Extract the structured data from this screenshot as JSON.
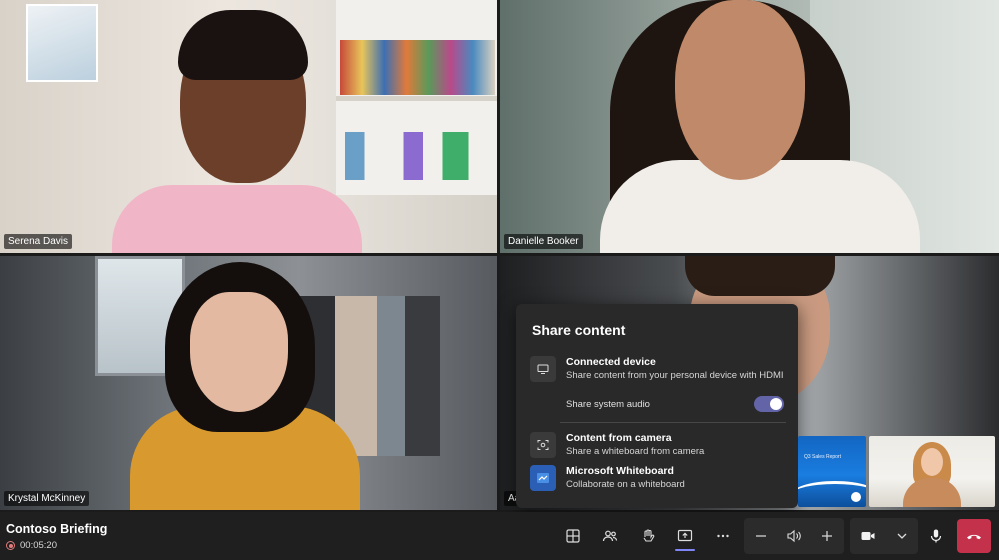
{
  "participants": [
    {
      "name": "Serena Davis"
    },
    {
      "name": "Danielle Booker"
    },
    {
      "name": "Krystal McKinney"
    },
    {
      "name": "Aa"
    }
  ],
  "share_panel": {
    "title": "Share content",
    "connected_device": {
      "title": "Connected device",
      "subtitle": "Share content from your personal device with HDMI"
    },
    "system_audio": {
      "label": "Share system audio",
      "enabled": true
    },
    "camera": {
      "title": "Content from camera",
      "subtitle": "Share a whiteboard from camera"
    },
    "whiteboard": {
      "title": "Microsoft Whiteboard",
      "subtitle": "Collaborate on a whiteboard"
    }
  },
  "thumbnails": {
    "slide_label": "Q3 Sales Report"
  },
  "meeting": {
    "title": "Contoso Briefing",
    "elapsed": "00:05:20"
  },
  "colors": {
    "accent": "#6264a7",
    "hangup": "#c4314b",
    "panel": "#292929",
    "toolbar": "#1f1f1f"
  },
  "icons": {
    "layout": "grid-icon",
    "people": "people-icon",
    "raise_hand": "hand-icon",
    "share": "share-screen-icon",
    "more": "more-icon",
    "volume_down": "minus-icon",
    "volume": "speaker-icon",
    "volume_up": "plus-icon",
    "camera": "video-camera-icon",
    "camera_options": "chevron-down-icon",
    "mic": "microphone-icon",
    "hangup": "phone-hangup-icon"
  }
}
